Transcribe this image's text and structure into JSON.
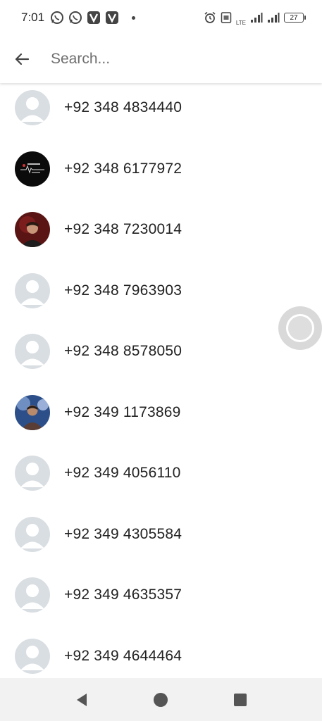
{
  "status_bar": {
    "time": "7:01",
    "notification_icons": [
      "whatsapp-icon",
      "whatsapp-icon",
      "vpn-v-icon",
      "vpn-v-icon"
    ],
    "lte_label": "LTE",
    "battery": "27",
    "icon_color": "#444444"
  },
  "search": {
    "placeholder": "Search..."
  },
  "contacts": [
    {
      "number": "+92 348 4834440",
      "avatar": "default-avatar"
    },
    {
      "number": "+92 348 6177972",
      "avatar": "photo-avatar-dark-text"
    },
    {
      "number": "+92 348 7230014",
      "avatar": "photo-avatar-person-red"
    },
    {
      "number": "+92 348 7963903",
      "avatar": "default-avatar"
    },
    {
      "number": "+92 348 8578050",
      "avatar": "default-avatar"
    },
    {
      "number": "+92 349 1173869",
      "avatar": "photo-avatar-person-blue"
    },
    {
      "number": "+92 349 4056110",
      "avatar": "default-avatar"
    },
    {
      "number": "+92 349 4305584",
      "avatar": "default-avatar"
    },
    {
      "number": "+92 349 4635357",
      "avatar": "default-avatar"
    },
    {
      "number": "+92 349 4644464",
      "avatar": "default-avatar"
    }
  ],
  "nav_bar": {
    "buttons": [
      "back-triangle-icon",
      "home-circle-icon",
      "recents-square-icon"
    ]
  },
  "colors": {
    "default_avatar_bg": "#d9dee3",
    "default_avatar_fg": "#ffffff",
    "nav_icon": "#555555"
  }
}
